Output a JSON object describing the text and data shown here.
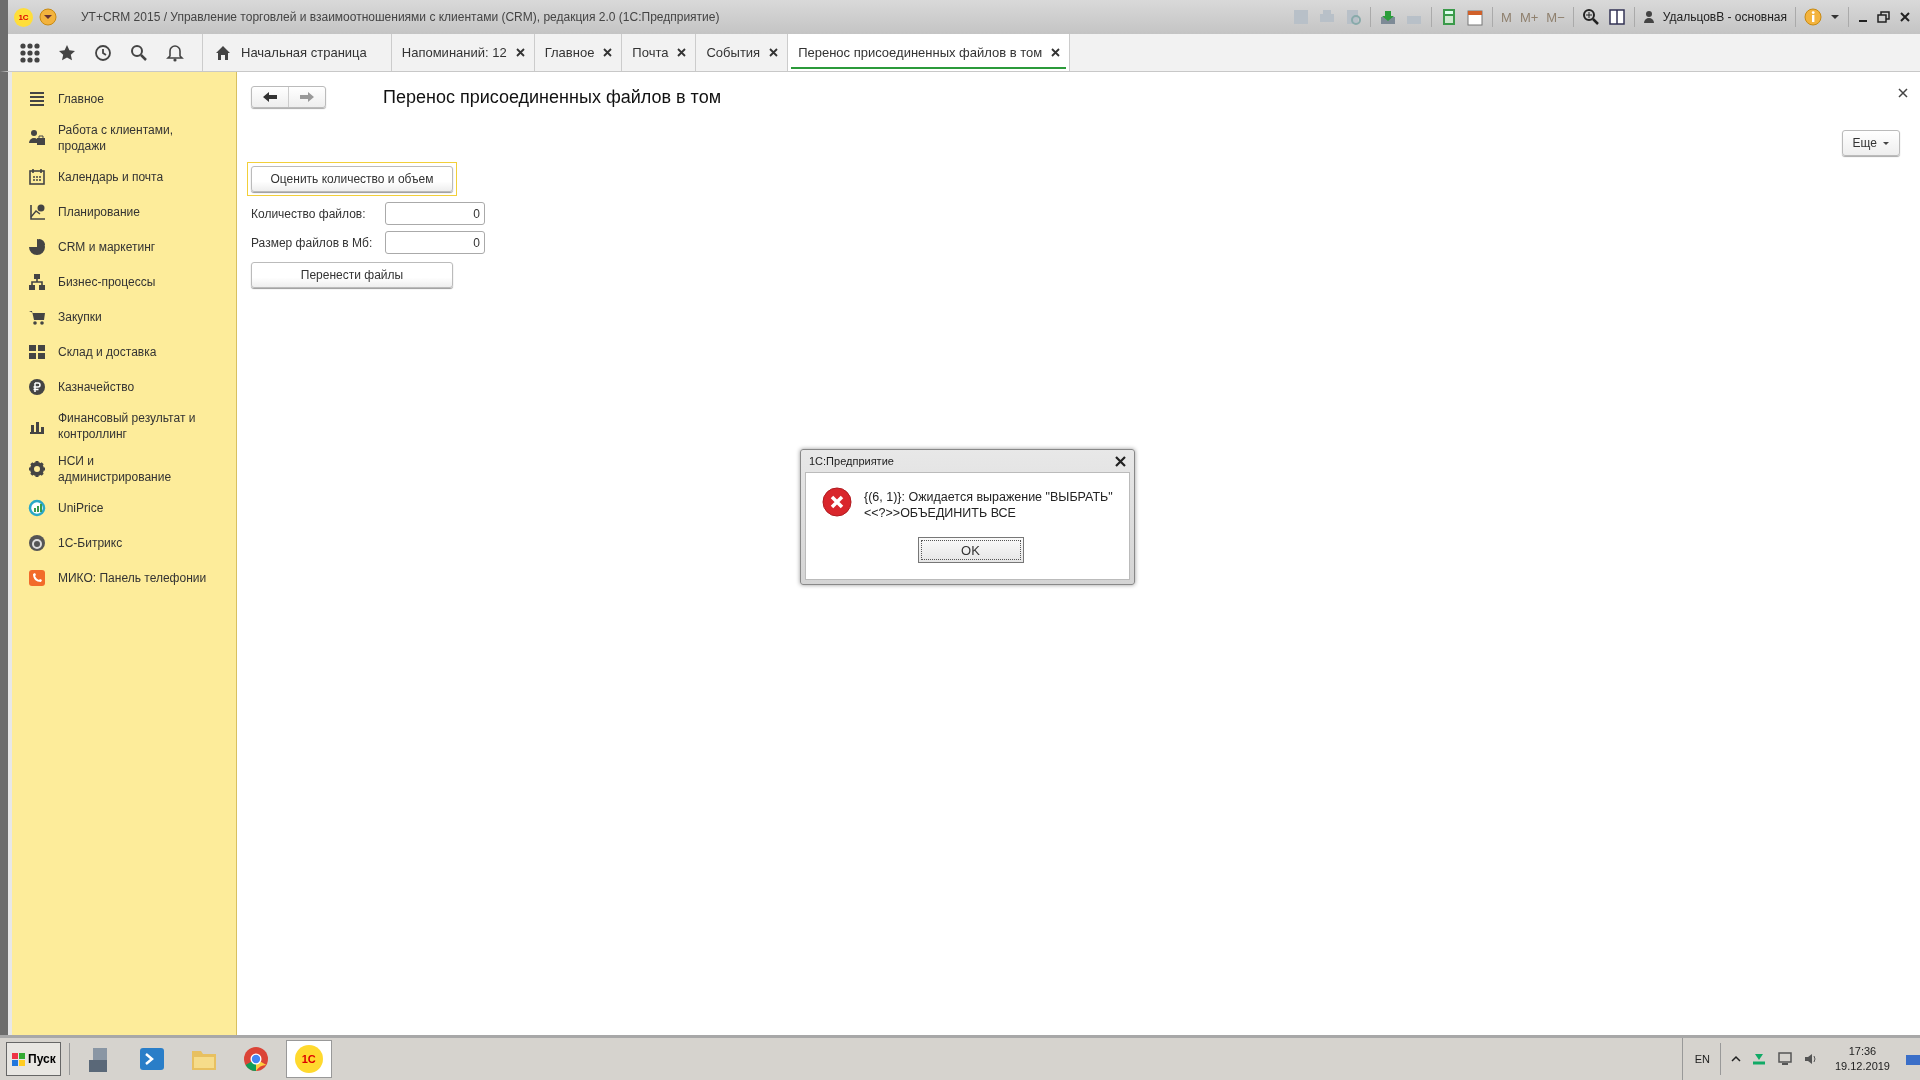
{
  "window": {
    "logo": "1С",
    "title": "УТ+CRM 2015 / Управление торговлей и взаимоотношениями с клиентами (CRM), редакция 2.0  (1С:Предприятие)",
    "memory_buttons": [
      {
        "label": "M",
        "disabled": true
      },
      {
        "label": "M+",
        "disabled": true
      },
      {
        "label": "M−",
        "disabled": true
      }
    ],
    "user": "УдальцовВ - основная"
  },
  "tabs": [
    {
      "label": "Начальная страница",
      "kind": "home",
      "selected": false
    },
    {
      "label": "Напоминаний: 12",
      "kind": "closable",
      "selected": false
    },
    {
      "label": "Главное",
      "kind": "closable",
      "selected": false
    },
    {
      "label": "Почта",
      "kind": "closable",
      "selected": false
    },
    {
      "label": "События",
      "kind": "closable",
      "selected": false
    },
    {
      "label": "Перенос присоединенных файлов в том",
      "kind": "closable",
      "selected": true
    }
  ],
  "sidebar": {
    "items": [
      "Главное",
      "Работа с клиентами, продажи",
      "Календарь и почта",
      "Планирование",
      "CRM и маркетинг",
      "Бизнес-процессы",
      "Закупки",
      "Склад и доставка",
      "Казначейство",
      "Финансовый результат и контроллинг",
      "НСИ и администрирование",
      "UniPrice",
      "1С-Битрикс",
      "МИКО: Панель телефонии"
    ]
  },
  "form": {
    "title": "Перенос присоединенных файлов в том",
    "more_button": "Еще",
    "estimate_button": {
      "label": "Оценить количество и объем",
      "focused": true
    },
    "fields": [
      {
        "label": "Количество файлов:",
        "value": "0"
      },
      {
        "label": "Размер файлов в Мб:",
        "value": "0"
      }
    ],
    "move_button": "Перенести файлы"
  },
  "dialog": {
    "title": "1С:Предприятие",
    "message": "{(6, 1)}: Ожидается выражение \"ВЫБРАТЬ\"\n<<?>>ОБЪЕДИНИТЬ ВСЕ",
    "ok_button": "OK"
  },
  "taskbar": {
    "start_button": "Пуск",
    "app_logo": "1С",
    "language": "EN",
    "time": "17:36",
    "date": "19.12.2019"
  }
}
